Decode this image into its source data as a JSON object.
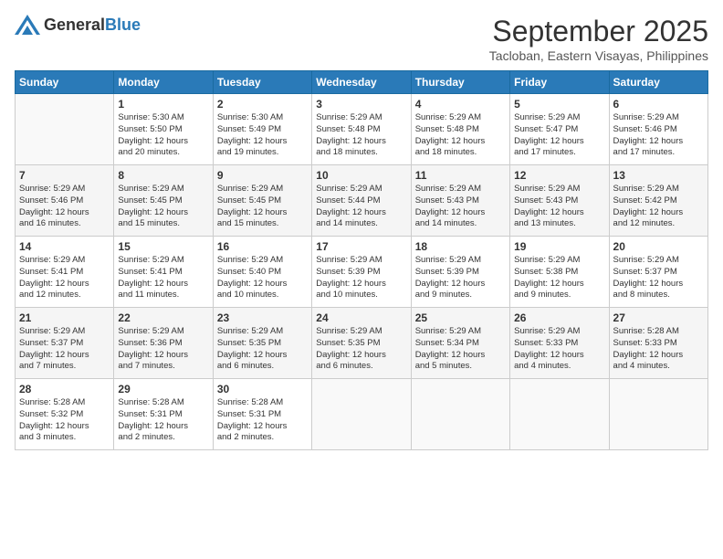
{
  "header": {
    "logo_general": "General",
    "logo_blue": "Blue",
    "month": "September 2025",
    "location": "Tacloban, Eastern Visayas, Philippines"
  },
  "days_of_week": [
    "Sunday",
    "Monday",
    "Tuesday",
    "Wednesday",
    "Thursday",
    "Friday",
    "Saturday"
  ],
  "weeks": [
    [
      {
        "day": "",
        "text": ""
      },
      {
        "day": "1",
        "text": "Sunrise: 5:30 AM\nSunset: 5:50 PM\nDaylight: 12 hours\nand 20 minutes."
      },
      {
        "day": "2",
        "text": "Sunrise: 5:30 AM\nSunset: 5:49 PM\nDaylight: 12 hours\nand 19 minutes."
      },
      {
        "day": "3",
        "text": "Sunrise: 5:29 AM\nSunset: 5:48 PM\nDaylight: 12 hours\nand 18 minutes."
      },
      {
        "day": "4",
        "text": "Sunrise: 5:29 AM\nSunset: 5:48 PM\nDaylight: 12 hours\nand 18 minutes."
      },
      {
        "day": "5",
        "text": "Sunrise: 5:29 AM\nSunset: 5:47 PM\nDaylight: 12 hours\nand 17 minutes."
      },
      {
        "day": "6",
        "text": "Sunrise: 5:29 AM\nSunset: 5:46 PM\nDaylight: 12 hours\nand 17 minutes."
      }
    ],
    [
      {
        "day": "7",
        "text": "Sunrise: 5:29 AM\nSunset: 5:46 PM\nDaylight: 12 hours\nand 16 minutes."
      },
      {
        "day": "8",
        "text": "Sunrise: 5:29 AM\nSunset: 5:45 PM\nDaylight: 12 hours\nand 15 minutes."
      },
      {
        "day": "9",
        "text": "Sunrise: 5:29 AM\nSunset: 5:45 PM\nDaylight: 12 hours\nand 15 minutes."
      },
      {
        "day": "10",
        "text": "Sunrise: 5:29 AM\nSunset: 5:44 PM\nDaylight: 12 hours\nand 14 minutes."
      },
      {
        "day": "11",
        "text": "Sunrise: 5:29 AM\nSunset: 5:43 PM\nDaylight: 12 hours\nand 14 minutes."
      },
      {
        "day": "12",
        "text": "Sunrise: 5:29 AM\nSunset: 5:43 PM\nDaylight: 12 hours\nand 13 minutes."
      },
      {
        "day": "13",
        "text": "Sunrise: 5:29 AM\nSunset: 5:42 PM\nDaylight: 12 hours\nand 12 minutes."
      }
    ],
    [
      {
        "day": "14",
        "text": "Sunrise: 5:29 AM\nSunset: 5:41 PM\nDaylight: 12 hours\nand 12 minutes."
      },
      {
        "day": "15",
        "text": "Sunrise: 5:29 AM\nSunset: 5:41 PM\nDaylight: 12 hours\nand 11 minutes."
      },
      {
        "day": "16",
        "text": "Sunrise: 5:29 AM\nSunset: 5:40 PM\nDaylight: 12 hours\nand 10 minutes."
      },
      {
        "day": "17",
        "text": "Sunrise: 5:29 AM\nSunset: 5:39 PM\nDaylight: 12 hours\nand 10 minutes."
      },
      {
        "day": "18",
        "text": "Sunrise: 5:29 AM\nSunset: 5:39 PM\nDaylight: 12 hours\nand 9 minutes."
      },
      {
        "day": "19",
        "text": "Sunrise: 5:29 AM\nSunset: 5:38 PM\nDaylight: 12 hours\nand 9 minutes."
      },
      {
        "day": "20",
        "text": "Sunrise: 5:29 AM\nSunset: 5:37 PM\nDaylight: 12 hours\nand 8 minutes."
      }
    ],
    [
      {
        "day": "21",
        "text": "Sunrise: 5:29 AM\nSunset: 5:37 PM\nDaylight: 12 hours\nand 7 minutes."
      },
      {
        "day": "22",
        "text": "Sunrise: 5:29 AM\nSunset: 5:36 PM\nDaylight: 12 hours\nand 7 minutes."
      },
      {
        "day": "23",
        "text": "Sunrise: 5:29 AM\nSunset: 5:35 PM\nDaylight: 12 hours\nand 6 minutes."
      },
      {
        "day": "24",
        "text": "Sunrise: 5:29 AM\nSunset: 5:35 PM\nDaylight: 12 hours\nand 6 minutes."
      },
      {
        "day": "25",
        "text": "Sunrise: 5:29 AM\nSunset: 5:34 PM\nDaylight: 12 hours\nand 5 minutes."
      },
      {
        "day": "26",
        "text": "Sunrise: 5:29 AM\nSunset: 5:33 PM\nDaylight: 12 hours\nand 4 minutes."
      },
      {
        "day": "27",
        "text": "Sunrise: 5:28 AM\nSunset: 5:33 PM\nDaylight: 12 hours\nand 4 minutes."
      }
    ],
    [
      {
        "day": "28",
        "text": "Sunrise: 5:28 AM\nSunset: 5:32 PM\nDaylight: 12 hours\nand 3 minutes."
      },
      {
        "day": "29",
        "text": "Sunrise: 5:28 AM\nSunset: 5:31 PM\nDaylight: 12 hours\nand 2 minutes."
      },
      {
        "day": "30",
        "text": "Sunrise: 5:28 AM\nSunset: 5:31 PM\nDaylight: 12 hours\nand 2 minutes."
      },
      {
        "day": "",
        "text": ""
      },
      {
        "day": "",
        "text": ""
      },
      {
        "day": "",
        "text": ""
      },
      {
        "day": "",
        "text": ""
      }
    ]
  ]
}
